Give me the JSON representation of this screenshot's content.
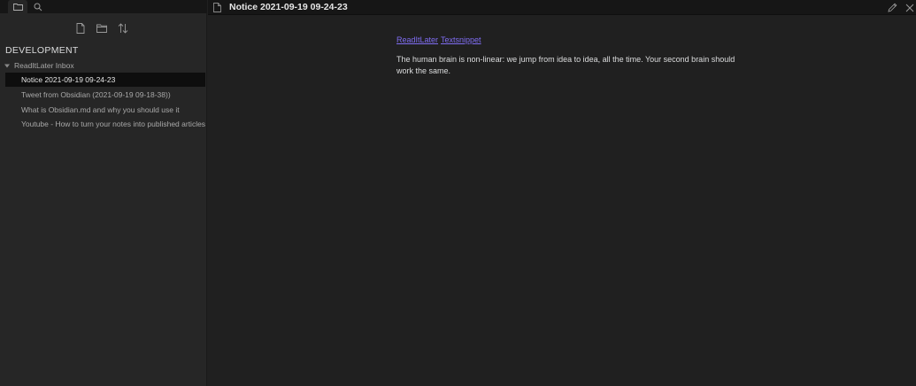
{
  "sidebar": {
    "vault_name": "DEVELOPMENT",
    "folder": {
      "name": "ReadItLater Inbox",
      "expanded": true
    },
    "files": [
      {
        "name": "Notice 2021-09-19 09-24-23",
        "active": true
      },
      {
        "name": "Tweet from Obsidian (2021-09-19 09-18-38))",
        "active": false
      },
      {
        "name": "What is Obsidian.md and why you should use it",
        "active": false
      },
      {
        "name": "Youtube - How to turn your notes into published articles",
        "active": false
      }
    ],
    "icons": {
      "tab_files": "folder-icon",
      "tab_search": "search-icon",
      "new_note": "new-note-icon",
      "new_folder": "new-folder-icon",
      "sort": "sort-icon",
      "folder_toggle": "chevron-down-icon"
    }
  },
  "main": {
    "title": "Notice 2021-09-19 09-24-23",
    "tags": [
      "ReadItLater",
      "Textsnippet"
    ],
    "body": "The human brain is non-linear: we jump from idea to idea, all the time. Your second brain should work the same.",
    "icons": {
      "doc": "document-icon",
      "edit": "pencil-icon",
      "close": "close-icon"
    }
  },
  "colors": {
    "accent": "#7f6df2",
    "background": "#202020",
    "sidebar": "#262626",
    "header": "#161616",
    "active_row": "#0e0e0e"
  }
}
